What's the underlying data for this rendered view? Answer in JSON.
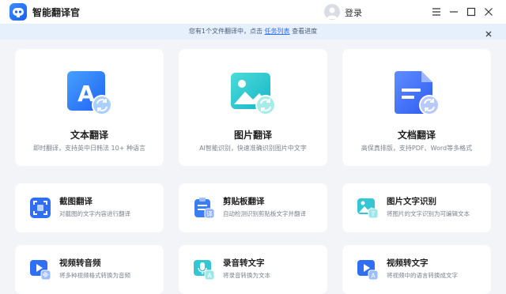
{
  "app": {
    "title": "智能翻译官",
    "login_label": "登录"
  },
  "notice": {
    "prefix": "您有1个文件翻译中，点击",
    "link": "任务列表",
    "suffix": "查看进度"
  },
  "big_cards": [
    {
      "title": "文本翻译",
      "desc": "即时翻译，支持英中日韩法 10+ 种语言",
      "icon": "text-translate-icon"
    },
    {
      "title": "图片翻译",
      "desc": "AI智能识别，快速准确识别图片中文字",
      "icon": "image-translate-icon"
    },
    {
      "title": "文档翻译",
      "desc": "高保真排版，支持PDF、Word等多格式",
      "icon": "document-translate-icon"
    }
  ],
  "small_cards": [
    {
      "title": "截图翻译",
      "desc": "对截图的文字内容进行翻译",
      "icon": "screenshot-translate-icon"
    },
    {
      "title": "剪贴板翻译",
      "desc": "自动检测识别剪贴板文字并翻译",
      "icon": "clipboard-translate-icon"
    },
    {
      "title": "图片文字识别",
      "desc": "将图片的文字识别为可编辑文本",
      "icon": "image-ocr-icon"
    },
    {
      "title": "视频转音频",
      "desc": "将多种视频格式转换为音频",
      "icon": "video-to-audio-icon"
    },
    {
      "title": "录音转文字",
      "desc": "将录音转换为文本",
      "icon": "audio-to-text-icon"
    },
    {
      "title": "视频转文字",
      "desc": "将视频中的语言转换成文字",
      "icon": "video-to-text-icon"
    }
  ],
  "colors": {
    "accent": "#2f6ef5",
    "notice_bg": "#e6f0fd",
    "page_bg": "#f2f4f8"
  }
}
